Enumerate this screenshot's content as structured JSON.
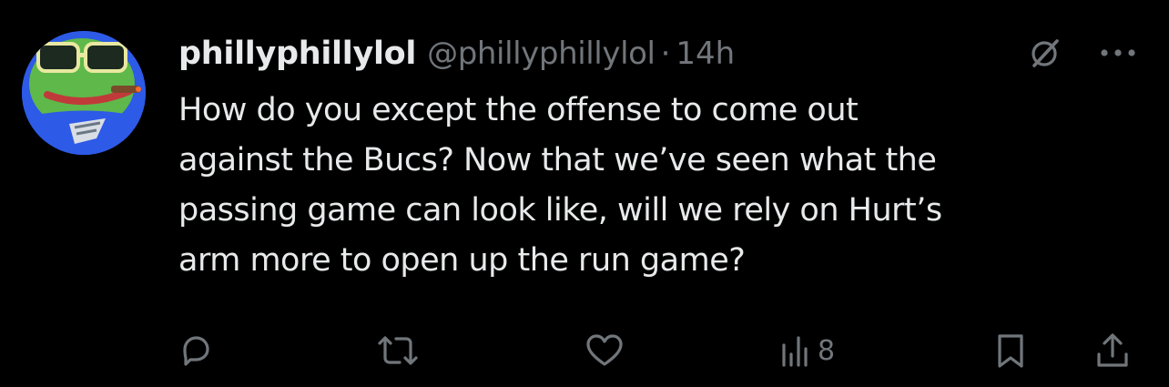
{
  "tweet": {
    "display_name": "phillyphillylol",
    "handle": "@phillyphillylol",
    "separator": "·",
    "time": "14h",
    "text_lines": [
      "How do you except the offense to come out",
      "against the Bucs? Now that we’ve seen what the",
      "passing game can look like, will we rely on Hurt’s",
      "arm more to open up the run game?"
    ]
  },
  "header_icons": {
    "grok": "grok-slash-icon",
    "more": "more-horizontal-icon"
  },
  "actions": {
    "reply": {
      "icon": "reply-icon"
    },
    "retweet": {
      "icon": "retweet-icon"
    },
    "like": {
      "icon": "heart-icon"
    },
    "views": {
      "icon": "views-chart-icon",
      "count": "8"
    },
    "bookmark": {
      "icon": "bookmark-icon"
    },
    "share": {
      "icon": "share-icon"
    }
  },
  "colors": {
    "background": "#000000",
    "primary_text": "#e7e9ea",
    "secondary_text": "#71767b",
    "avatar_bg": "#2d5ae6",
    "avatar_frog": "#5fb84a"
  }
}
